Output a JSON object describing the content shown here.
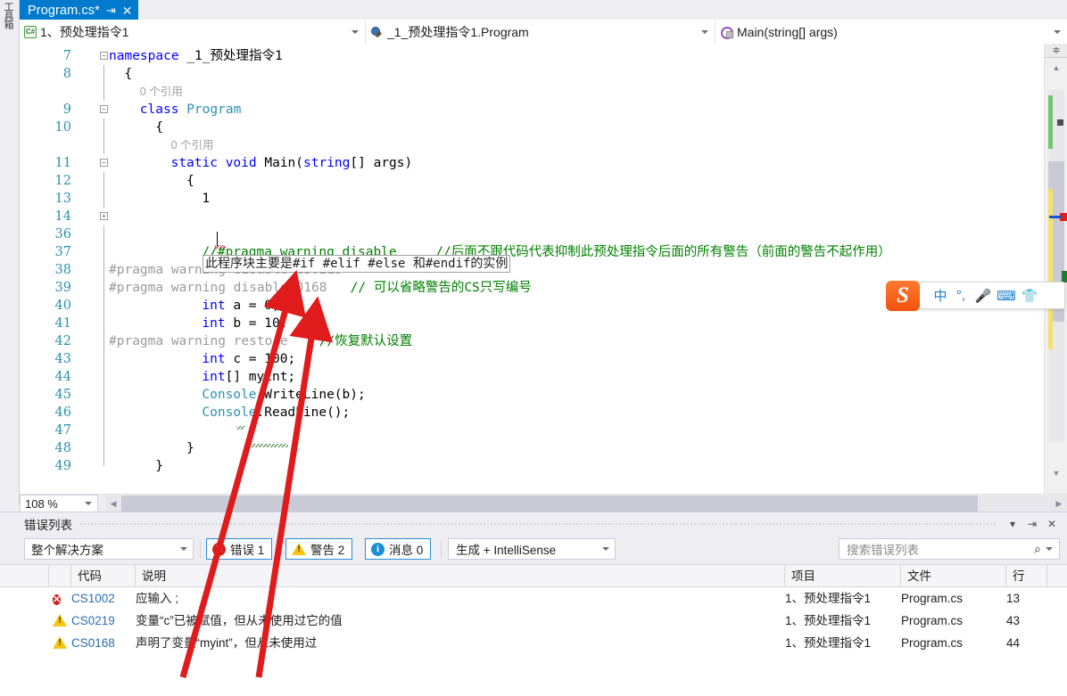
{
  "window": {
    "toolbox_label": "工具箱"
  },
  "tab": {
    "filename": "Program.cs*",
    "pin_icon": "pin-icon",
    "close_icon": "close-icon"
  },
  "navbar": {
    "project": "1、预处理指令1",
    "type": "_1_预处理指令1.Program",
    "member": "Main(string[] args)",
    "project_icon": "csharp-file-icon",
    "type_icon": "class-icon",
    "member_icon": "method-icon"
  },
  "editor": {
    "zoom_level": "108 %",
    "collapsed_region_text": "此程序块主要是#if #elif #else 和#endif的实例",
    "lines": [
      {
        "num": "7",
        "fold": "minus",
        "indent": 0,
        "tokens": [
          {
            "t": "namespace ",
            "c": "kw"
          },
          {
            "t": "_1_预处理指令1",
            "c": "plain"
          }
        ]
      },
      {
        "num": "8",
        "fold": "line",
        "indent": 1,
        "tokens": [
          {
            "t": "{",
            "c": "plain"
          }
        ]
      },
      {
        "num": "",
        "fold": "line",
        "indent": 2,
        "tokens": [
          {
            "t": "0 个引用",
            "c": "ref"
          }
        ]
      },
      {
        "num": "9",
        "fold": "minus",
        "indent": 2,
        "tokens": [
          {
            "t": "class ",
            "c": "kw"
          },
          {
            "t": "Program",
            "c": "type"
          }
        ]
      },
      {
        "num": "10",
        "fold": "line",
        "indent": 3,
        "tokens": [
          {
            "t": "{",
            "c": "plain"
          }
        ]
      },
      {
        "num": "",
        "fold": "line",
        "indent": 4,
        "tokens": [
          {
            "t": "0 个引用",
            "c": "ref"
          }
        ]
      },
      {
        "num": "11",
        "fold": "minus",
        "indent": 4,
        "tokens": [
          {
            "t": "static ",
            "c": "kw"
          },
          {
            "t": "void ",
            "c": "kw"
          },
          {
            "t": "Main(",
            "c": "plain"
          },
          {
            "t": "string",
            "c": "kw"
          },
          {
            "t": "[] args)",
            "c": "plain"
          }
        ]
      },
      {
        "num": "12",
        "fold": "line",
        "indent": 5,
        "tokens": [
          {
            "t": "{",
            "c": "plain"
          }
        ]
      },
      {
        "num": "13",
        "fold": "line",
        "indent": 6,
        "tokens": [
          {
            "t": "1",
            "c": "plain"
          }
        ]
      },
      {
        "num": "14",
        "fold": "plus",
        "indent": 6,
        "tokens": []
      },
      {
        "num": "36",
        "fold": "line",
        "indent": 0,
        "tokens": []
      },
      {
        "num": "37",
        "fold": "line",
        "indent": 6,
        "tokens": [
          {
            "t": "//#pragma warning disable     //后面不跟代码代表抑制此预处理指令后面的所有警告（前面的警告不起作用）",
            "c": "com"
          }
        ]
      },
      {
        "num": "38",
        "fold": "line",
        "indent": -1,
        "tokens": [
          {
            "t": "#pragma warning disable CS0219",
            "c": "pre"
          }
        ]
      },
      {
        "num": "39",
        "fold": "line",
        "indent": -1,
        "tokens": [
          {
            "t": "#pragma warning disable 0168",
            "c": "pre"
          },
          {
            "t": "   // 可以省略警告的CS只写编号",
            "c": "com"
          }
        ]
      },
      {
        "num": "40",
        "fold": "line",
        "indent": 6,
        "tokens": [
          {
            "t": "int",
            "c": "kw"
          },
          {
            "t": " a = ",
            "c": "plain"
          },
          {
            "t": "0",
            "c": "plain"
          },
          {
            "t": ";",
            "c": "plain"
          }
        ]
      },
      {
        "num": "41",
        "fold": "line",
        "indent": 6,
        "tokens": [
          {
            "t": "int",
            "c": "kw"
          },
          {
            "t": " b = ",
            "c": "plain"
          },
          {
            "t": "10",
            "c": "plain"
          },
          {
            "t": ";",
            "c": "plain"
          }
        ]
      },
      {
        "num": "42",
        "fold": "line",
        "indent": -1,
        "tokens": [
          {
            "t": "#pragma warning restore",
            "c": "pre"
          },
          {
            "t": "    //恢复默认设置",
            "c": "com"
          }
        ]
      },
      {
        "num": "43",
        "fold": "line",
        "indent": 6,
        "tokens": [
          {
            "t": "int",
            "c": "kw"
          },
          {
            "t": " c = ",
            "c": "plain"
          },
          {
            "t": "100",
            "c": "plain"
          },
          {
            "t": ";",
            "c": "plain"
          }
        ]
      },
      {
        "num": "44",
        "fold": "line",
        "indent": 6,
        "tokens": [
          {
            "t": "int",
            "c": "kw"
          },
          {
            "t": "[] myint;",
            "c": "plain"
          }
        ]
      },
      {
        "num": "45",
        "fold": "line",
        "indent": 6,
        "tokens": [
          {
            "t": "Console",
            "c": "type"
          },
          {
            "t": ".WriteLine(b);",
            "c": "plain"
          }
        ]
      },
      {
        "num": "46",
        "fold": "line",
        "indent": 6,
        "tokens": [
          {
            "t": "Console",
            "c": "type"
          },
          {
            "t": ".ReadLine();",
            "c": "plain"
          }
        ]
      },
      {
        "num": "47",
        "fold": "line",
        "indent": 0,
        "tokens": []
      },
      {
        "num": "48",
        "fold": "line",
        "indent": 5,
        "tokens": [
          {
            "t": "}",
            "c": "plain"
          }
        ]
      },
      {
        "num": "49",
        "fold": "endline",
        "indent": 3,
        "tokens": [
          {
            "t": "}",
            "c": "plain"
          }
        ]
      }
    ]
  },
  "error_panel": {
    "title": "错误列表",
    "scope_filter": "整个解决方案",
    "errors_label": "错误 1",
    "warnings_label": "警告 2",
    "messages_label": "消息 0",
    "build_filter": "生成 + IntelliSense",
    "search_placeholder": "搜索错误列表",
    "columns": [
      "",
      "",
      "代码",
      "说明",
      "项目",
      "文件",
      "行"
    ],
    "rows": [
      {
        "severity": "error",
        "code": "CS1002",
        "description": "应输入 ;",
        "project": "1、预处理指令1",
        "file": "Program.cs",
        "line": "13"
      },
      {
        "severity": "warning",
        "code": "CS0219",
        "description": "变量“c”已被赋值，但从未使用过它的值",
        "project": "1、预处理指令1",
        "file": "Program.cs",
        "line": "43"
      },
      {
        "severity": "warning",
        "code": "CS0168",
        "description": "声明了变量“myint”，但从未使用过",
        "project": "1、预处理指令1",
        "file": "Program.cs",
        "line": "44"
      }
    ]
  },
  "ime": {
    "logo": "sogou-logo",
    "mode": "中",
    "punct": "°,",
    "mic_icon": "microphone-icon",
    "keyboard_icon": "keyboard-icon",
    "skin_icon": "skin-icon"
  },
  "colors": {
    "accent": "#007acc",
    "keyword": "#0000ff",
    "type": "#2b91af",
    "comment": "#008000",
    "preprocessor": "#9b9b9b",
    "error": "#d91c1c",
    "warning": "#f5c518",
    "info": "#1a8fd4",
    "annotation_arrow": "#e01b1b"
  }
}
